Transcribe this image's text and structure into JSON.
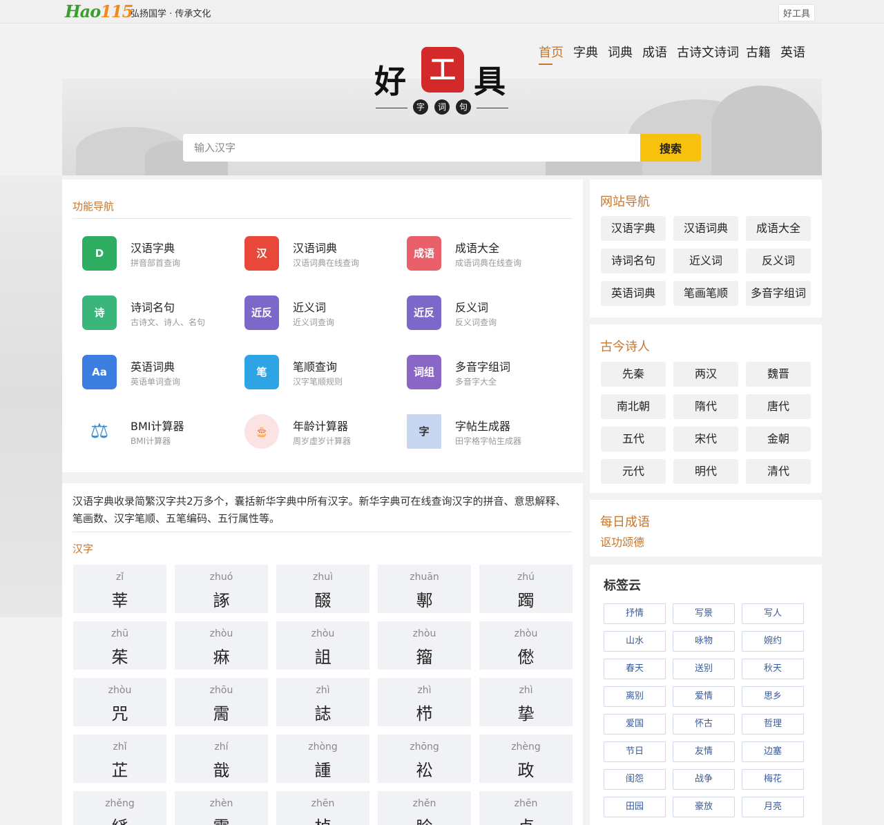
{
  "topbar": {
    "logo_main": "Hao",
    "logo_num": "115",
    "slogan": "弘扬国学 · 传承文化",
    "right_link": "好工具"
  },
  "brand": {
    "char1": "好",
    "seal_char": "工",
    "char3": "具",
    "sub": [
      "字",
      "词",
      "句"
    ]
  },
  "nav": {
    "items": [
      "首页",
      "字典",
      "词典",
      "成语",
      "古诗文诗词",
      "古籍",
      "英语"
    ],
    "active_index": 0
  },
  "search": {
    "placeholder": "输入汉字",
    "button": "搜索"
  },
  "function_nav": {
    "title": "功能导航",
    "items": [
      {
        "name": "汉语字典",
        "desc": "拼音部首查询",
        "icon": "dictionary-icon",
        "icon_text": "D",
        "color": "#2fae62"
      },
      {
        "name": "汉语词典",
        "desc": "汉语词典在线查询",
        "icon": "word-dictionary-icon",
        "icon_text": "汉",
        "color": "#e8473a"
      },
      {
        "name": "成语大全",
        "desc": "成语词典在线查询",
        "icon": "idiom-icon",
        "icon_text": "成语",
        "color": "#e9606a"
      },
      {
        "name": "诗词名句",
        "desc": "古诗文、诗人、名句",
        "icon": "poetry-icon",
        "icon_text": "诗",
        "color": "#3ab67a"
      },
      {
        "name": "近义词",
        "desc": "近义词查询",
        "icon": "synonym-icon",
        "icon_text": "近反",
        "color": "#7b68c8"
      },
      {
        "name": "反义词",
        "desc": "反义词查询",
        "icon": "antonym-icon",
        "icon_text": "近反",
        "color": "#7b68c8"
      },
      {
        "name": "英语词典",
        "desc": "英语单词查询",
        "icon": "english-icon",
        "icon_text": "Aa",
        "color": "#3c7de0"
      },
      {
        "name": "笔顺查询",
        "desc": "汉字笔顺规则",
        "icon": "stroke-order-icon",
        "icon_text": "笔",
        "color": "#2ea4e6"
      },
      {
        "name": "多音字组词",
        "desc": "多音字大全",
        "icon": "polyphone-icon",
        "icon_text": "词组",
        "color": "#8a66c6"
      },
      {
        "name": "BMI计算器",
        "desc": "BMI计算器",
        "icon": "bmi-scale-icon",
        "icon_text": "⚖",
        "color": "#2f8fe0"
      },
      {
        "name": "年龄计算器",
        "desc": "周岁虚岁计算器",
        "icon": "birthday-cake-icon",
        "icon_text": "🎂",
        "color": "#fbe3e3"
      },
      {
        "name": "字帖生成器",
        "desc": "田字格字帖生成器",
        "icon": "copybook-icon",
        "icon_text": "字",
        "color": "#c9d6f2"
      }
    ]
  },
  "hanzi": {
    "intro": "汉语字典收录简繁汉字共2万多个，囊括新华字典中所有汉字。新华字典可在线查询汉字的拼音、意思解释、笔画数、汉字笔顺、五笔编码、五行属性等。",
    "title": "汉字",
    "cells": [
      {
        "py": "zǐ",
        "hz": "莘"
      },
      {
        "py": "zhuó",
        "hz": "諑"
      },
      {
        "py": "zhuì",
        "hz": "醊"
      },
      {
        "py": "zhuān",
        "hz": "鄟"
      },
      {
        "py": "zhú",
        "hz": "躅"
      },
      {
        "py": "zhū",
        "hz": "茱"
      },
      {
        "py": "zhòu",
        "hz": "痳"
      },
      {
        "py": "zhòu",
        "hz": "詛"
      },
      {
        "py": "zhòu",
        "hz": "籀"
      },
      {
        "py": "zhòu",
        "hz": "僽"
      },
      {
        "py": "zhòu",
        "hz": "咒"
      },
      {
        "py": "zhōu",
        "hz": "霌"
      },
      {
        "py": "zhì",
        "hz": "誌"
      },
      {
        "py": "zhì",
        "hz": "栉"
      },
      {
        "py": "zhì",
        "hz": "挚"
      },
      {
        "py": "zhǐ",
        "hz": "芷"
      },
      {
        "py": "zhí",
        "hz": "戠"
      },
      {
        "py": "zhòng",
        "hz": "諥"
      },
      {
        "py": "zhōng",
        "hz": "衳"
      },
      {
        "py": "zhèng",
        "hz": "政"
      },
      {
        "py": "zhěng",
        "hz": "絼"
      },
      {
        "py": "zhèn",
        "hz": "震"
      },
      {
        "py": "zhēn",
        "hz": "楨"
      },
      {
        "py": "zhěn",
        "hz": "眕"
      },
      {
        "py": "zhēn",
        "hz": "贞"
      }
    ]
  },
  "site_nav": {
    "title": "网站导航",
    "items": [
      "汉语字典",
      "汉语词典",
      "成语大全",
      "诗词名句",
      "近义词",
      "反义词",
      "英语词典",
      "笔画笔顺",
      "多音字组词"
    ]
  },
  "poets": {
    "title": "古今诗人",
    "items": [
      "先秦",
      "两汉",
      "魏晋",
      "南北朝",
      "隋代",
      "唐代",
      "五代",
      "宋代",
      "金朝",
      "元代",
      "明代",
      "清代"
    ]
  },
  "daily_idiom": {
    "title": "每日成语",
    "idiom": "讴功颂德"
  },
  "tag_cloud": {
    "title": "标签云",
    "items": [
      "抒情",
      "写景",
      "写人",
      "山水",
      "咏物",
      "婉约",
      "春天",
      "送别",
      "秋天",
      "离别",
      "爱情",
      "思乡",
      "爱国",
      "怀古",
      "哲理",
      "节日",
      "友情",
      "边塞",
      "闺怨",
      "战争",
      "梅花",
      "田园",
      "豪放",
      "月亮"
    ]
  },
  "colors": {
    "accent": "#c8762c",
    "search_button": "#f7c10d",
    "seal": "#d22a2a",
    "tag_text": "#3a5a9a"
  }
}
